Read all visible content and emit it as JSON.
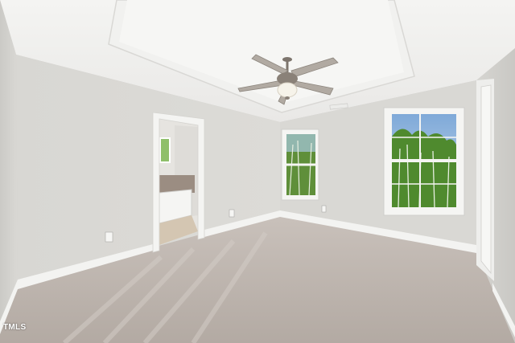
{
  "watermark": {
    "text": "TMLS"
  }
}
